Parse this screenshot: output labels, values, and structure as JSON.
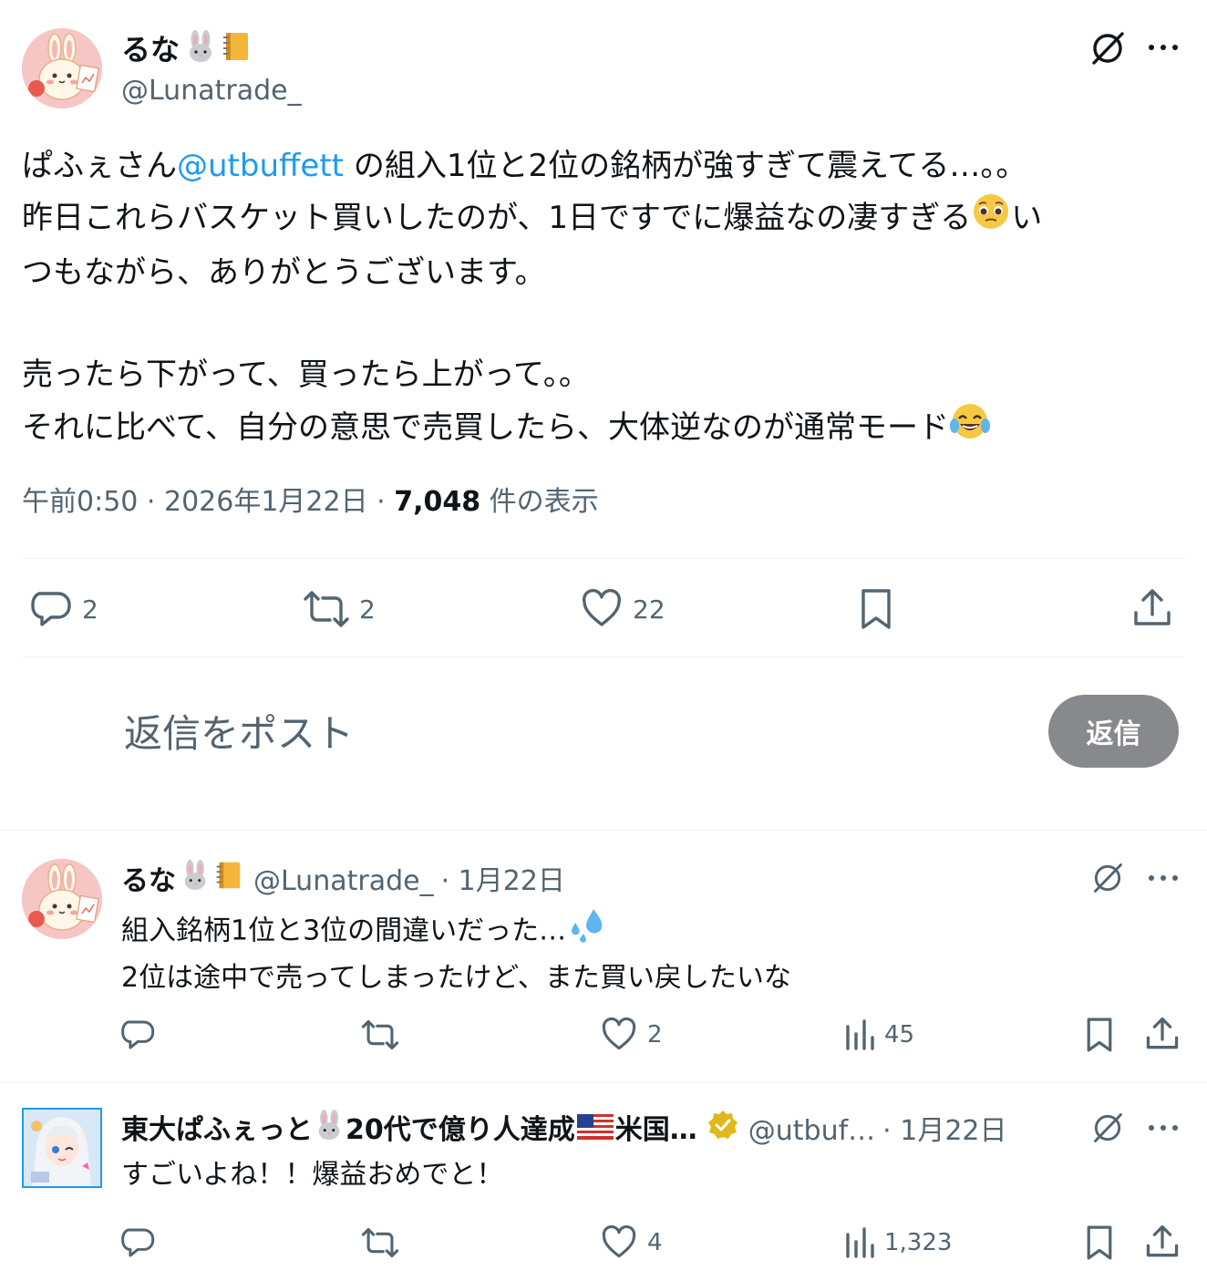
{
  "main_tweet": {
    "author_name": "るな",
    "author_handle": "@Lunatrade_",
    "text_line1_pre": "ぱふぇさん",
    "text_line1_mention": "@utbuffett",
    "text_line1_post": " の組入1位と2位の銘柄が強すぎて震えてる…。。",
    "text_line2": "昨日これらバスケット買いしたのが、1日ですでに爆益なの凄すぎる",
    "text_line2_tail": "い",
    "text_line3": "つもながら、ありがとうございます。",
    "text_line4": "売ったら下がって、買ったら上がって。。",
    "text_line5": "それに比べて、自分の意思で売買したら、大体逆なのが通常モード",
    "meta_time": "午前0:50 · 2026年1月22日 · ",
    "meta_views": "7,048",
    "meta_views_suffix": " 件の表示",
    "reply_count": "2",
    "repost_count": "2",
    "like_count": "22"
  },
  "composer": {
    "placeholder": "返信をポスト",
    "reply_button": "返信"
  },
  "replies": [
    {
      "author_name": "るな",
      "author_handle": "@Lunatrade_",
      "date": "· 1月22日",
      "line1": "組入銘柄1位と3位の間違いだった…",
      "line2": "2位は途中で売ってしまったけど、また買い戻したいな",
      "reply_count": "",
      "repost_count": "",
      "like_count": "2",
      "views": "45"
    },
    {
      "author_name": "東大ぱふぇっと",
      "author_name_mid": "20代で億り人達成",
      "author_name_tail": "米国…",
      "author_handle": "@utbuf…",
      "date": "· 1月22日",
      "line1": "すごいよね！！爆益おめでと！",
      "reply_count": "",
      "repost_count": "",
      "like_count": "4",
      "views": "1,323"
    }
  ],
  "icons": {
    "grok": "grok-slash-icon",
    "more": "more-dots-icon",
    "reply": "reply-bubble-icon",
    "repost": "repost-arrows-icon",
    "like": "heart-icon",
    "bookmark": "bookmark-icon",
    "share": "share-upload-icon",
    "views": "bar-chart-icon"
  },
  "colors": {
    "link": "#1d9bf0",
    "muted": "#536471",
    "reply_button_bg": "#87898c",
    "verified": "#e2b719"
  }
}
